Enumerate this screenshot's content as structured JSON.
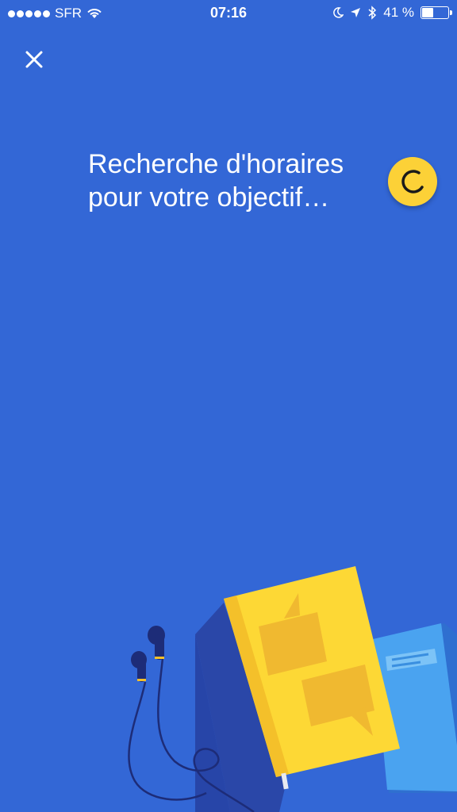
{
  "status_bar": {
    "carrier": "SFR",
    "time": "07:16",
    "battery_percent_label": "41 %",
    "battery_level": 0.41,
    "icons": [
      "signal-dots-icon",
      "wifi-icon",
      "moon-icon",
      "location-arrow-icon",
      "bluetooth-icon",
      "battery-icon"
    ]
  },
  "close_button": {
    "icon": "close-icon"
  },
  "heading": {
    "line1": "Recherche d'horaires",
    "line2": "pour votre objectif…"
  },
  "loader": {
    "icon": "spinner-icon",
    "color": "#fcd137"
  },
  "illustration": {
    "items": [
      "book-illustration",
      "notebook-illustration",
      "earphones-illustration"
    ]
  },
  "colors": {
    "background": "#3367d6",
    "accent_yellow": "#fcd137",
    "book_yellow": "#fdd835",
    "notebook_blue": "#4aa3f0"
  }
}
